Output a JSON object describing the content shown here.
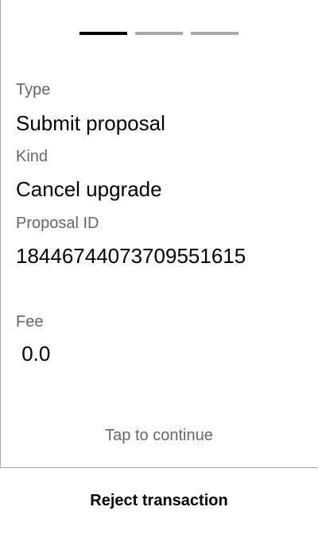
{
  "progress": {
    "steps": 3,
    "current": 1
  },
  "fields": [
    {
      "label": "Type",
      "value": "Submit proposal"
    },
    {
      "label": "Kind",
      "value": "Cancel upgrade"
    },
    {
      "label": "Proposal ID",
      "value": "18446744073709551615"
    },
    {
      "label": "Fee",
      "value": " 0.0"
    }
  ],
  "tap_hint": "Tap to continue",
  "reject_label": "Reject transaction",
  "colors": {
    "active_step": "#000000",
    "inactive_step": "#a8a8a8",
    "label": "#666666"
  }
}
